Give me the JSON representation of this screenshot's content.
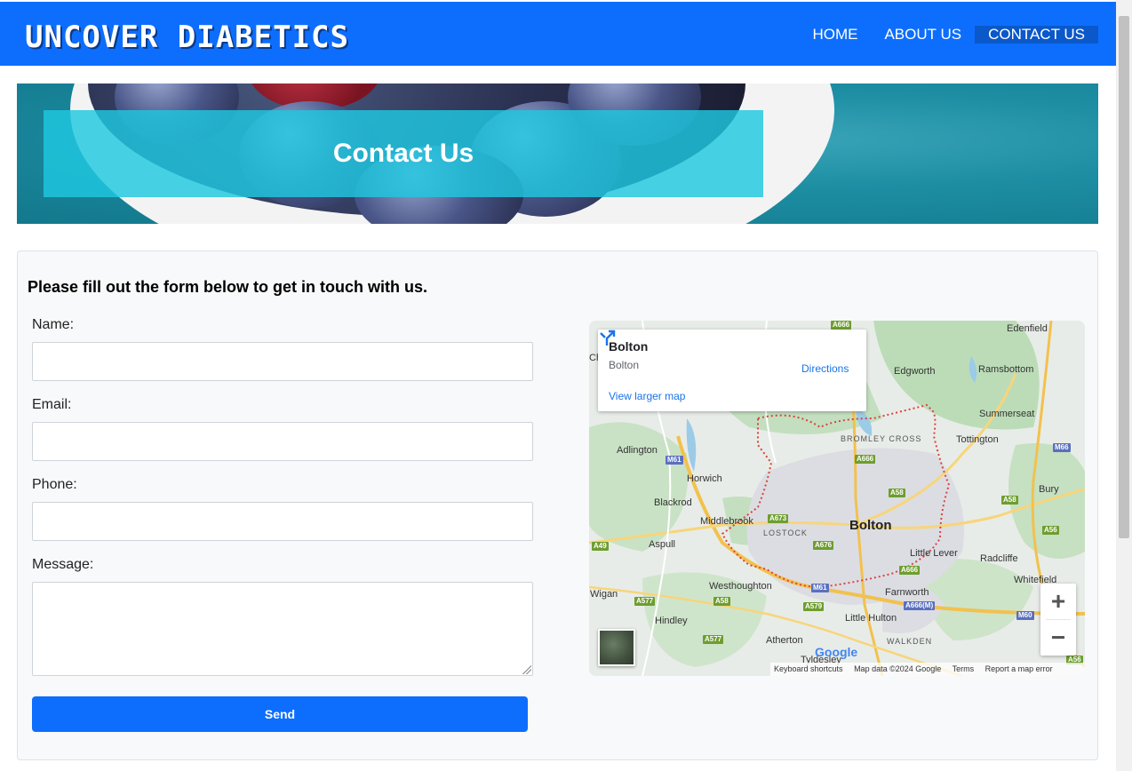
{
  "header": {
    "brand": "UNCOVER DIABETICS",
    "nav": [
      {
        "label": "HOME",
        "active": false
      },
      {
        "label": "ABOUT US",
        "active": false
      },
      {
        "label": "CONTACT US",
        "active": true
      }
    ],
    "color": "#0d6efd"
  },
  "hero": {
    "title": "Contact Us"
  },
  "form": {
    "intro": "Please fill out the form below to get in touch with us.",
    "name_label": "Name:",
    "name_value": "",
    "email_label": "Email:",
    "email_value": "",
    "phone_label": "Phone:",
    "phone_value": "",
    "message_label": "Message:",
    "message_value": "",
    "send_label": "Send"
  },
  "map": {
    "place_title": "Bolton",
    "place_subtitle": "Bolton",
    "directions_label": "Directions",
    "larger_map_label": "View larger map",
    "google_logo": "Google",
    "attribution": {
      "keyboard": "Keyboard shortcuts",
      "data": "Map data ©2024 Google",
      "terms": "Terms",
      "report": "Report a map error"
    },
    "zoom_in": "+",
    "zoom_out": "−",
    "places": [
      "Edenfield",
      "Edgworth",
      "Ramsbottom",
      "Summerseat",
      "Tottington",
      "Bury",
      "Adlington",
      "Horwich",
      "Blackrod",
      "Middlebrook",
      "Bolton",
      "Aspull",
      "Little Lever",
      "Radcliffe",
      "Whitefield",
      "Westhoughton",
      "Farnworth",
      "Wigan",
      "Hindley",
      "Little Hulton",
      "Atherton",
      "Tyldesley",
      "Ch",
      "ch"
    ],
    "caps_places": [
      "BROMLEY CROSS",
      "LOSTOCK",
      "WALKDEN"
    ],
    "roads": [
      "A666",
      "M61",
      "A666",
      "A58",
      "A58",
      "M66",
      "A673",
      "A676",
      "A56",
      "A49",
      "A666",
      "M61",
      "A666(M)",
      "A577",
      "A58",
      "A579",
      "M60",
      "A577",
      "A56"
    ]
  }
}
